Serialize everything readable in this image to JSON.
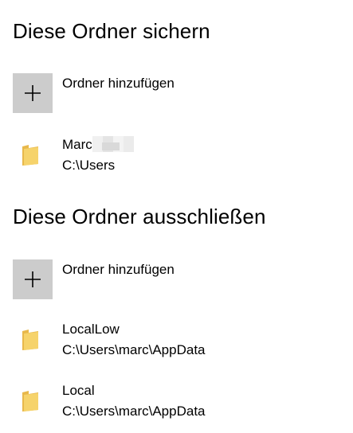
{
  "include_section": {
    "title": "Diese Ordner sichern",
    "add_button_label": "Ordner hinzufügen",
    "folders": [
      {
        "name": "Marc",
        "path": "C:\\Users"
      }
    ]
  },
  "exclude_section": {
    "title": "Diese Ordner ausschließen",
    "add_button_label": "Ordner hinzufügen",
    "folders": [
      {
        "name": "LocalLow",
        "path": "C:\\Users\\marc\\AppData"
      },
      {
        "name": "Local",
        "path": "C:\\Users\\marc\\AppData"
      }
    ]
  },
  "icons": {
    "add": "plus-icon",
    "folder": "folder-icon"
  },
  "colors": {
    "add_button_bg": "#cccccc",
    "folder_yellow": "#f6d36b",
    "folder_dark": "#e8b84b"
  }
}
